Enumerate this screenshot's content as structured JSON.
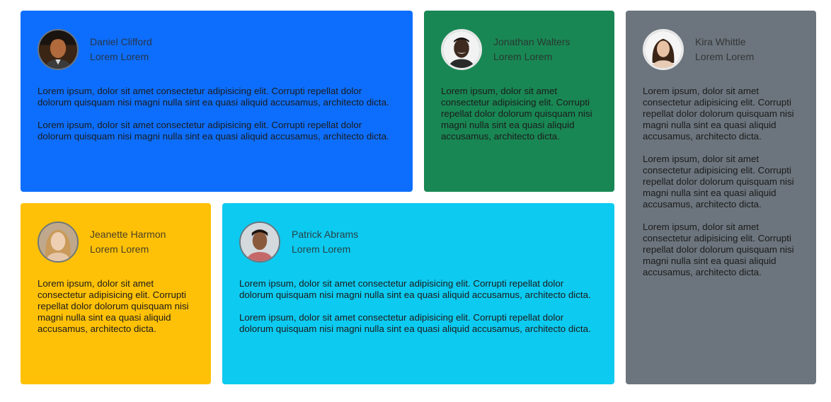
{
  "colors": {
    "card_blue": "#0d6efd",
    "card_green": "#198754",
    "card_gray": "#6c757d",
    "card_yellow": "#ffc107",
    "card_cyan": "#0dcaf0"
  },
  "cards": [
    {
      "name": "Daniel Clifford",
      "role": "Lorem Lorem",
      "paragraphs": [
        "Lorem ipsum, dolor sit amet consectetur adipisicing elit. Corrupti repellat dolor dolorum quisquam nisi magni nulla sint ea quasi aliquid accusamus, architecto dicta.",
        "Lorem ipsum, dolor sit amet consectetur adipisicing elit. Corrupti repellat dolor dolorum quisquam nisi magni nulla sint ea quasi aliquid accusamus, architecto dicta."
      ]
    },
    {
      "name": "Jonathan Walters",
      "role": "Lorem Lorem",
      "paragraphs": [
        "Lorem ipsum, dolor sit amet consectetur adipisicing elit. Corrupti repellat dolor dolorum quisquam nisi magni nulla sint ea quasi aliquid accusamus, architecto dicta."
      ]
    },
    {
      "name": "Kira Whittle",
      "role": "Lorem Lorem",
      "paragraphs": [
        "Lorem ipsum, dolor sit amet consectetur adipisicing elit. Corrupti repellat dolor dolorum quisquam nisi magni nulla sint ea quasi aliquid accusamus, architecto dicta.",
        "Lorem ipsum, dolor sit amet consectetur adipisicing elit. Corrupti repellat dolor dolorum quisquam nisi magni nulla sint ea quasi aliquid accusamus, architecto dicta.",
        "Lorem ipsum, dolor sit amet consectetur adipisicing elit. Corrupti repellat dolor dolorum quisquam nisi magni nulla sint ea quasi aliquid accusamus, architecto dicta."
      ]
    },
    {
      "name": "Jeanette Harmon",
      "role": "Lorem Lorem",
      "paragraphs": [
        "Lorem ipsum, dolor sit amet consectetur adipisicing elit. Corrupti repellat dolor dolorum quisquam nisi magni nulla sint ea quasi aliquid accusamus, architecto dicta."
      ]
    },
    {
      "name": "Patrick Abrams",
      "role": "Lorem Lorem",
      "paragraphs": [
        "Lorem ipsum, dolor sit amet consectetur adipisicing elit. Corrupti repellat dolor dolorum quisquam nisi magni nulla sint ea quasi aliquid accusamus, architecto dicta.",
        "Lorem ipsum, dolor sit amet consectetur adipisicing elit. Corrupti repellat dolor dolorum quisquam nisi magni nulla sint ea quasi aliquid accusamus, architecto dicta."
      ]
    }
  ]
}
